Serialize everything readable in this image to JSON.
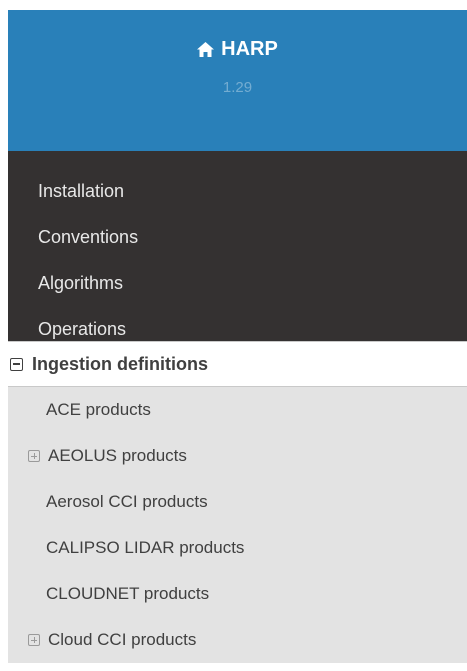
{
  "header": {
    "brand": "HARP",
    "version": "1.29",
    "brand_icon": "home-icon",
    "color": "#2980b9"
  },
  "menu": {
    "items": [
      {
        "label": "Installation"
      },
      {
        "label": "Conventions"
      },
      {
        "label": "Algorithms"
      },
      {
        "label": "Operations"
      }
    ],
    "dark_bg": "#343131"
  },
  "current": {
    "label": "Ingestion definitions",
    "toggle_icon": "minus-square-icon",
    "children": [
      {
        "label": "ACE products",
        "expandable": false
      },
      {
        "label": "AEOLUS products",
        "expandable": true
      },
      {
        "label": "Aerosol CCI products",
        "expandable": false
      },
      {
        "label": "CALIPSO LIDAR products",
        "expandable": false
      },
      {
        "label": "CLOUDNET products",
        "expandable": false
      },
      {
        "label": "Cloud CCI products",
        "expandable": true
      }
    ]
  }
}
